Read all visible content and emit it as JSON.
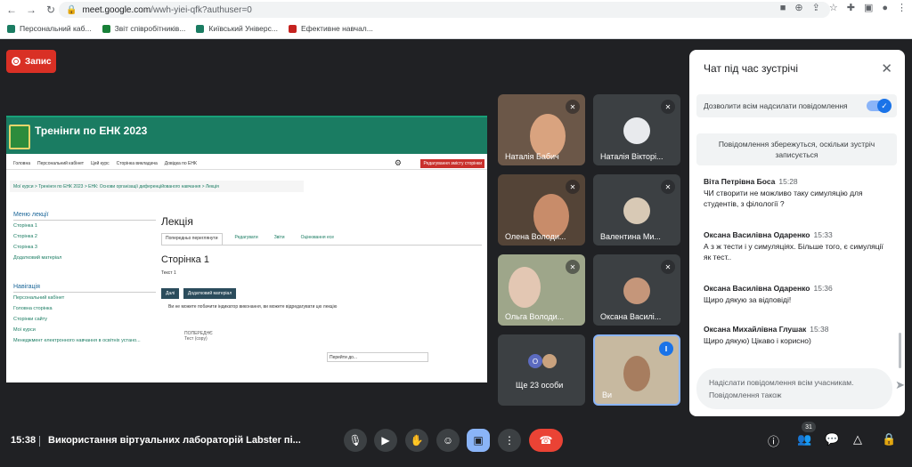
{
  "browser": {
    "url_host": "meet.google.com",
    "url_path": "/wwh-yiei-qfk?authuser=0",
    "bookmarks": [
      {
        "label": "Персональний каб...",
        "color": "#1a7c62"
      },
      {
        "label": "Звіт співробітників...",
        "color": "#188038"
      },
      {
        "label": "Київський Універс...",
        "color": "#1a7c62"
      },
      {
        "label": "Ефективне навчал...",
        "color": "#c5221f"
      }
    ]
  },
  "recording": {
    "label": "Запис"
  },
  "shared_screen": {
    "site_title": "Тренінги по ЕНК 2023",
    "nav": [
      "Головна",
      "Персональний кабінет",
      "Цей курс",
      "Сторінка викладача",
      "Довідка по ЕНК"
    ],
    "edit_button": "Редагування змісту сторінки",
    "breadcrumb": "Мої курси  >  Тренінги по ЕНК 2023  >  ЕНК: Основи організації диференційованого навчання  >  Лекція",
    "menu_title": "Меню лекції",
    "menu_items": [
      "Сторінка 1",
      "Сторінка 2",
      "Сторінка 3",
      "Додатковий матеріал"
    ],
    "nav_title": "Навігація",
    "nav_items": [
      "Персональний кабінет",
      "Головна сторінка",
      "Сторінки сайту",
      "Мої курси",
      "Менеджмент електронного навчання в освітніх устано..."
    ],
    "lecture_title": "Лекція",
    "tabs": [
      "Попередньо переглянути",
      "Редагувати",
      "Звіти",
      "Оцінювання есе"
    ],
    "page_title": "Сторінка 1",
    "page_text": "Текст 1",
    "btn_next": "Далі",
    "btn_extra": "Додатковий матеріал",
    "progress_note": "Ви не можете побачити індикатор виконання, ви можете відредагувати цю лекцію",
    "prev_label": "ПОПЕРЕДНЄ",
    "prev_sub": "Тест (copy)",
    "goto": "Перейти до..."
  },
  "participants": [
    {
      "name": "Наталія Бабич"
    },
    {
      "name": "Наталія Вікторі..."
    },
    {
      "name": "Олена Володи..."
    },
    {
      "name": "Валентина Ми..."
    },
    {
      "name": "Ольга Володи..."
    },
    {
      "name": "Оксана Василі..."
    },
    {
      "name": "Ще 23 особи"
    },
    {
      "name": "Ви"
    }
  ],
  "chat": {
    "title": "Чат під час зустрічі",
    "allow": "Дозволити всім надсилати повідомлення",
    "saved": "Повідомлення збережуться, оскільки зустріч записується",
    "messages": [
      {
        "who": "Віта Петрівна Боса",
        "time": "15:28",
        "text": "ЧИ створити не можливо таку симуляцію для студентів, з філології ?"
      },
      {
        "who": "Оксана Василівна Одаренко",
        "time": "15:33",
        "text": "А з ж тести і у симуляціях. Більше того, є симуляції як тест.."
      },
      {
        "who": "Оксана Василівна Одаренко",
        "time": "15:36",
        "text": "Щиро дякую за відповіді!"
      },
      {
        "who": "Оксана Михайлівна Глушак",
        "time": "15:38",
        "text": "Щиро дякую) Цікаво і корисно)"
      }
    ],
    "placeholder": "Надіслати повідомлення всім учасникам. Повідомлення також"
  },
  "bar": {
    "time": "15:38",
    "meeting_title": "Використання віртуальних лабораторій Labster пі...",
    "people_count": "31"
  }
}
